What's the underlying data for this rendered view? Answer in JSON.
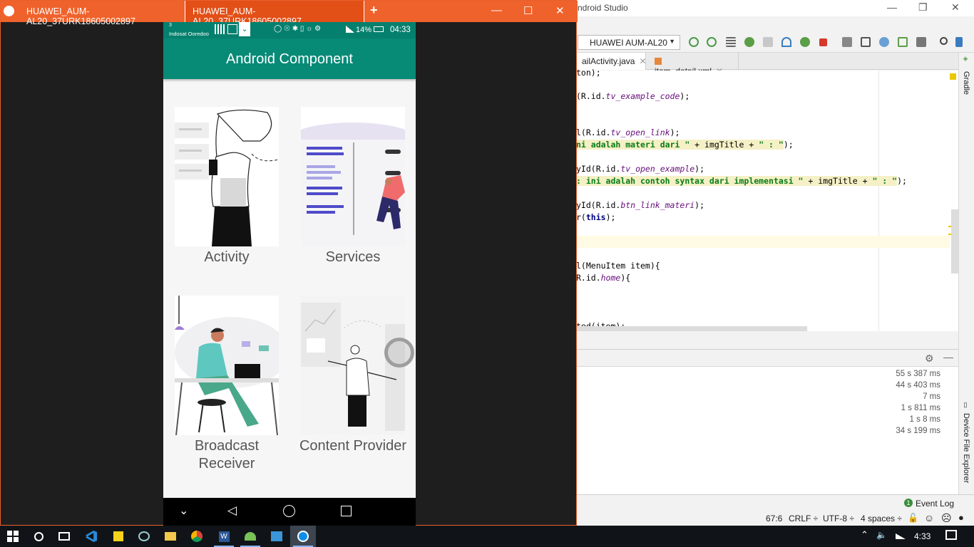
{
  "studio": {
    "title": "ndroid Studio",
    "device": "HUAWEI AUM-AL20",
    "tabs": [
      {
        "label": "ailActivity.java"
      },
      {
        "label": "item_detail.xml"
      }
    ],
    "code": {
      "l1": "ton);",
      "l2a": "(R.id.",
      "l2f": "tv_example_code",
      "l2b": ");",
      "l3a": "l(R.id.",
      "l3f": "tv_open_link",
      "l3b": ");",
      "l4s": "ni adalah materi dari \"",
      "l4b": " + imgTitle + ",
      "l4s2": "\" : \"",
      "l4c": ");",
      "l5a": "yId(R.id.",
      "l5f": "tv_open_example",
      "l5b": ");",
      "l6s": ": ini adalah contoh syntax dari implementasi \"",
      "l6b": " + imgTitle + ",
      "l6s2": "\" : \"",
      "l6c": ");",
      "l7a": "yId(R.id.",
      "l7f": "btn_link_materi",
      "l7b": ");",
      "l8a": "r(",
      "l8k": "this",
      "l8b": ");",
      "l9": "l(MenuItem item){",
      "l10a": "R.id.",
      "l10f": "home",
      "l10b": "){",
      "l11": "ted(item);"
    },
    "timings": [
      "55 s 387 ms",
      "44 s 403 ms",
      "7 ms",
      "1 s 811 ms",
      "1 s 8 ms",
      "34 s 199 ms"
    ],
    "gradle_label": "Gradle",
    "device_explorer_label": "Device File Explorer",
    "event_log": "Event Log",
    "event_log_count": "1",
    "status": {
      "position": "67:6",
      "line_sep": "CRLF ÷",
      "encoding": "UTF-8 ÷",
      "indent": "4 spaces ÷"
    }
  },
  "scrcpy": {
    "tabs": [
      {
        "label": "HUAWEI_AUM-AL20_37URK18605002897"
      },
      {
        "label": "HUAWEI_AUM-AL20_37URK18605002897"
      }
    ],
    "add_tab": "+"
  },
  "phone": {
    "carrier_num": "3",
    "carrier": "Indosat Ooredoo",
    "battery": "14%",
    "time": "04:33",
    "app_title": "Android Component",
    "cards": [
      {
        "label": "Activity"
      },
      {
        "label": "Services"
      },
      {
        "label": "Broadcast Receiver"
      },
      {
        "label": "Content Provider"
      }
    ]
  },
  "taskbar": {
    "time": "4:33"
  },
  "colors": {
    "app_bar": "#078a76",
    "scrcpy_title": "#f0622b",
    "taskbar": "#101418"
  }
}
